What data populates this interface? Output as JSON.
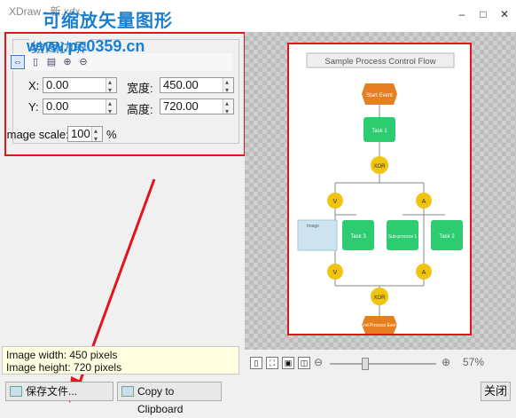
{
  "window": {
    "title": "XDraw - 新.xdx",
    "dialog_title": "可缩放矢量图形",
    "watermark": "www.pc0359.cn",
    "close_label": "关闭"
  },
  "bounds": {
    "group_label": "绘图边界",
    "x_label": "X:",
    "x_value": "0.00",
    "y_label": "Y:",
    "y_value": "0.00",
    "width_label": "宽度:",
    "width_value": "450.00",
    "height_label": "高度:",
    "height_value": "720.00",
    "scale_label": "Image scale:",
    "scale_value": "100",
    "scale_unit": "%"
  },
  "info": {
    "width_line": "Image width: 450 pixels",
    "height_line": "Image height: 720 pixels"
  },
  "buttons": {
    "save": "保存文件...",
    "copy": "Copy to Clipboard"
  },
  "zoom": {
    "percent": "57%",
    "level": 0.33
  },
  "flow": {
    "title": "Sample Process Control Flow",
    "start": "Start Event",
    "task1": "Task 1",
    "xor": "XOR",
    "v": "V",
    "a": "A",
    "task3": "Task 3",
    "sub": "Sub-process 1",
    "task2": "Task 2",
    "image": "Image",
    "end": "End Process Event"
  },
  "colors": {
    "accent": "#1a7fd0",
    "highlight": "#e3141b",
    "task": "#2ecc71",
    "gateway": "#f1c40f",
    "event": "#e67e22"
  }
}
